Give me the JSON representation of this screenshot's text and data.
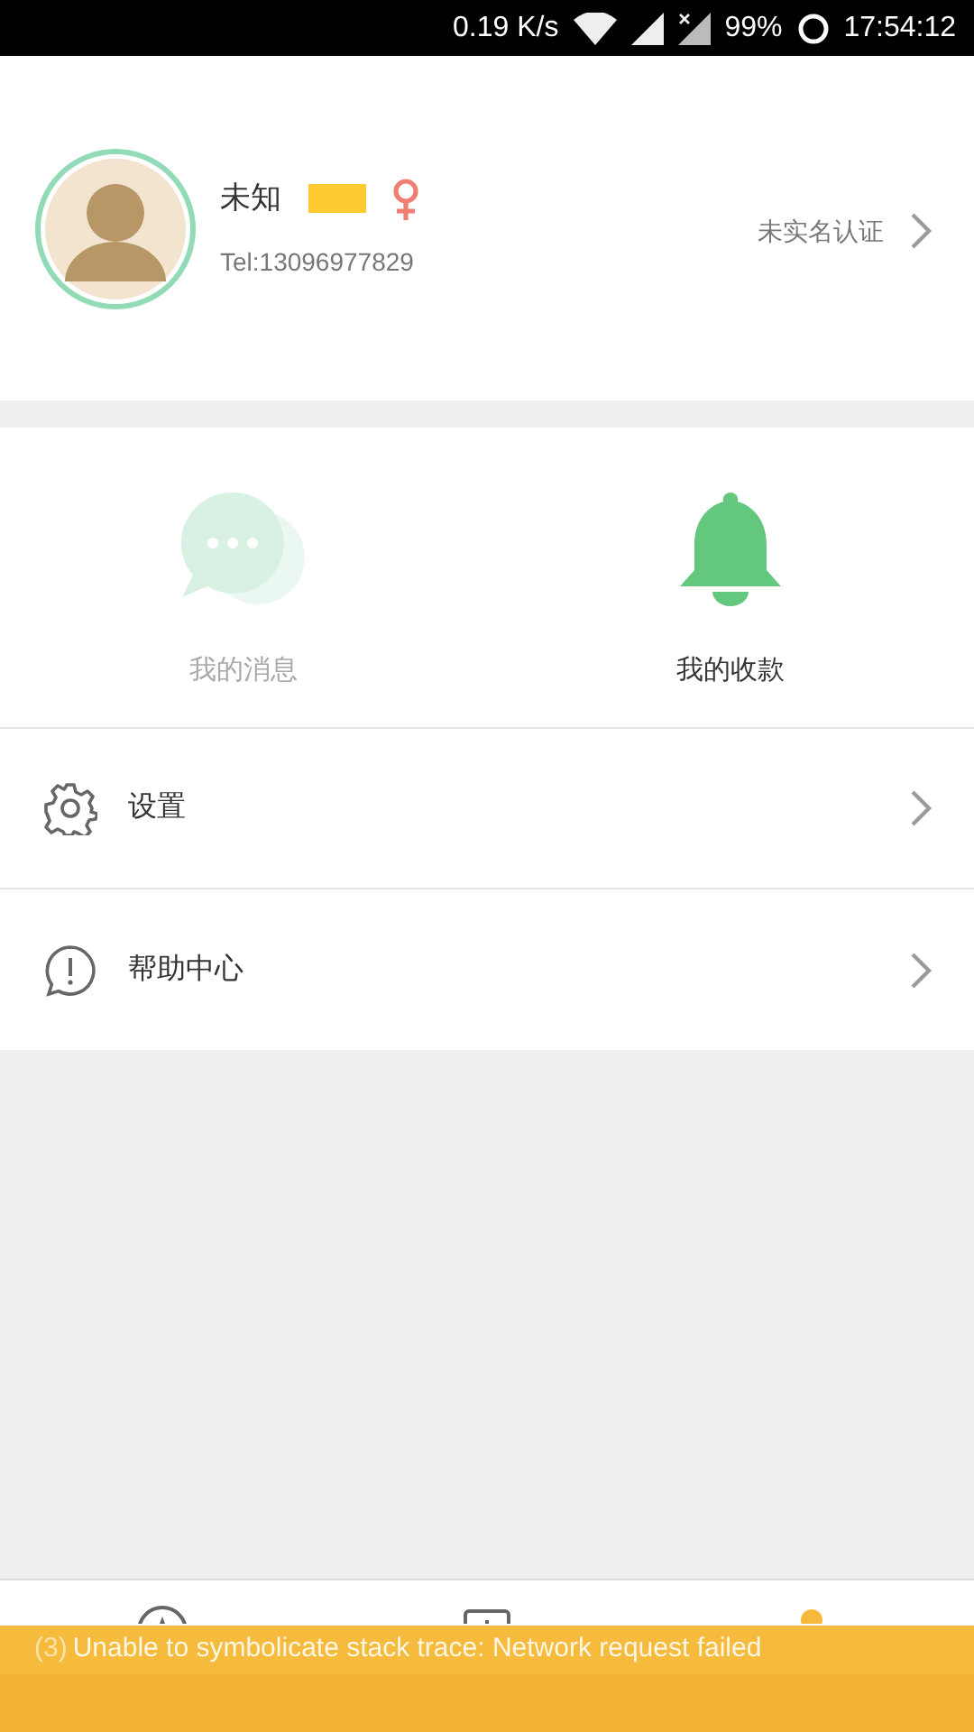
{
  "status_bar": {
    "speed": "0.19 K/s",
    "battery": "99%",
    "time": "17:54:12"
  },
  "profile": {
    "name": "未知",
    "phone": "Tel:13096977829",
    "verify_link": "未实名认证"
  },
  "shortcuts": [
    {
      "kind": "messages",
      "label": "我的消息",
      "disabled": true
    },
    {
      "kind": "income",
      "label": "我的收款",
      "disabled": false
    }
  ],
  "menu": [
    {
      "kind": "settings",
      "label": "设置"
    },
    {
      "kind": "help",
      "label": "帮助中心"
    }
  ],
  "tab_bar": [
    {
      "kind": "home",
      "selected": false
    },
    {
      "kind": "withdraw",
      "selected": false
    },
    {
      "kind": "me",
      "selected": true
    }
  ],
  "toast": {
    "count": "(3)",
    "message": "Unable to symbolicate stack trace: Network request failed"
  }
}
